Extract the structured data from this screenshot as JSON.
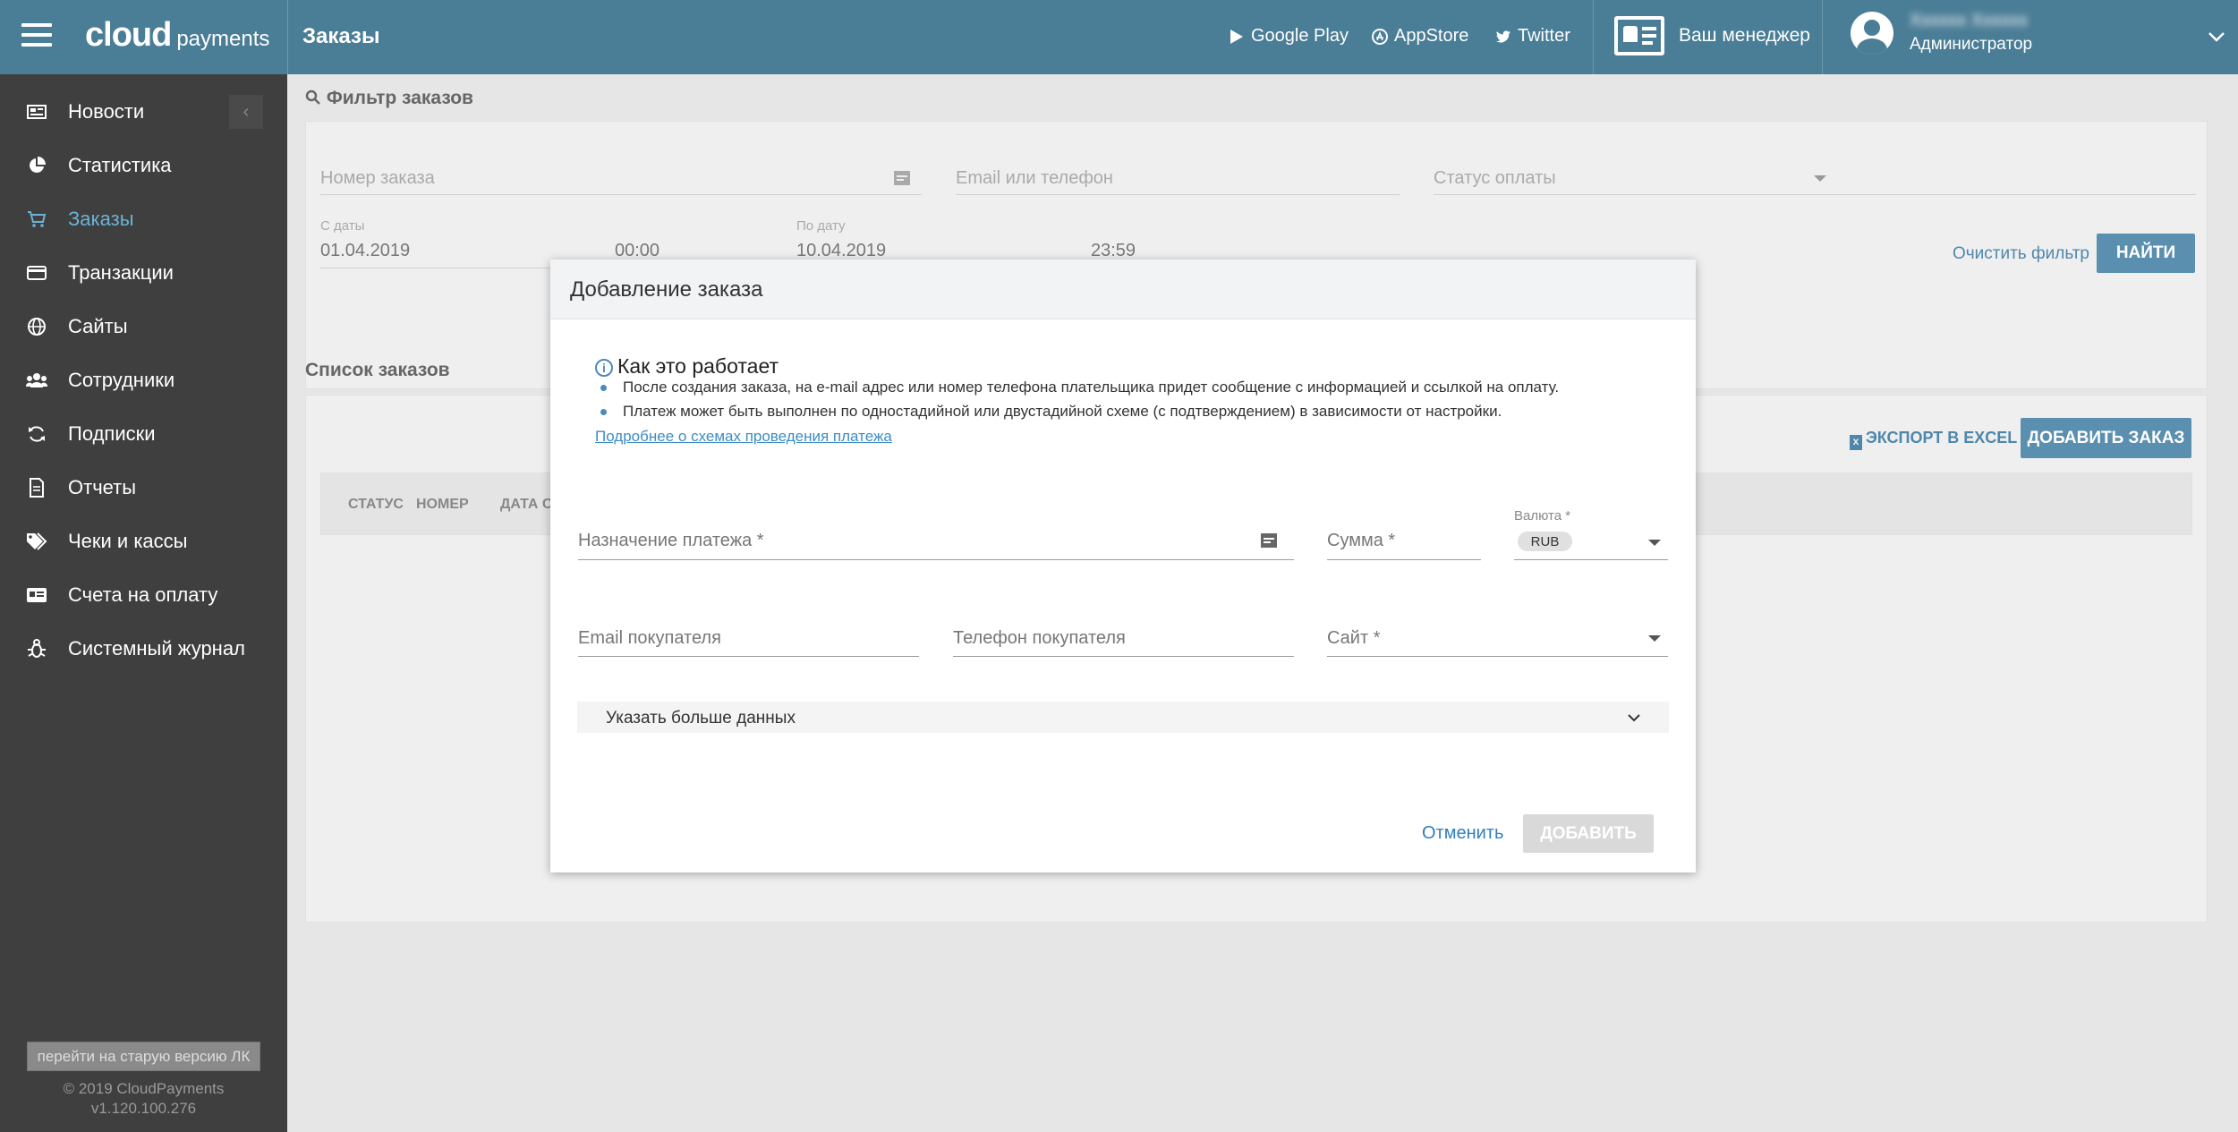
{
  "header": {
    "logo_main": "cloud",
    "logo_sub": "payments",
    "page_title": "Заказы",
    "links": [
      {
        "label": "Google Play",
        "icon": "play-icon"
      },
      {
        "label": "AppStore",
        "icon": "appstore-icon"
      },
      {
        "label": "Twitter",
        "icon": "twitter-icon"
      }
    ],
    "manager_label": "Ваш менеджер",
    "user_name": "Хххххх Хххххх",
    "user_role": "Администратор"
  },
  "sidebar": {
    "items": [
      {
        "label": "Новости",
        "icon": "news-icon"
      },
      {
        "label": "Статистика",
        "icon": "pie-chart-icon"
      },
      {
        "label": "Заказы",
        "icon": "cart-icon",
        "active": true
      },
      {
        "label": "Транзакции",
        "icon": "card-icon"
      },
      {
        "label": "Сайты",
        "icon": "globe-icon"
      },
      {
        "label": "Сотрудники",
        "icon": "users-icon"
      },
      {
        "label": "Подписки",
        "icon": "refresh-icon"
      },
      {
        "label": "Отчеты",
        "icon": "document-icon"
      },
      {
        "label": "Чеки и кассы",
        "icon": "tags-icon"
      },
      {
        "label": "Счета на оплату",
        "icon": "invoice-icon"
      },
      {
        "label": "Системный журнал",
        "icon": "bug-icon"
      }
    ],
    "old_version": "перейти на старую версию ЛК",
    "copyright": "© 2019 CloudPayments",
    "version": "v1.120.100.276"
  },
  "filter": {
    "title": "Фильтр заказов",
    "order_number_placeholder": "Номер заказа",
    "email_phone_placeholder": "Email или телефон",
    "payment_status_placeholder": "Статус оплаты",
    "date_from_label": "С даты",
    "date_from": "01.04.2019",
    "time_from": "00:00",
    "date_to_label": "По дату",
    "date_to": "10.04.2019",
    "time_to": "23:59",
    "clear_label": "Очистить фильтр",
    "find_label": "НАЙТИ"
  },
  "orders": {
    "title": "Список заказов",
    "export_label": "ЭКСПОРТ В EXCEL",
    "add_label": "ДОБАВИТЬ ЗАКАЗ",
    "columns": [
      "СТАТУС",
      "НОМЕР",
      "ДАТА СО"
    ]
  },
  "modal": {
    "title": "Добавление заказа",
    "info_title": "Как это работает",
    "bullets": [
      "После создания заказа, на e-mail адрес или номер телефона плательщика придет сообщение с информацией и ссылкой на оплату.",
      "Платеж может быть выполнен по одностадийной или двустадийной схеме (с подтверждением) в зависимости от настройки."
    ],
    "more_link": "Подробнее о схемах проведения платежа",
    "purpose_label": "Назначение платежа  *",
    "amount_label": "Сумма *",
    "currency_label": "Валюта *",
    "currency_value": "RUB",
    "email_label": "Email покупателя",
    "phone_label": "Телефон покупателя",
    "site_label": "Сайт *",
    "more_data_label": "Указать больше данных",
    "cancel_label": "Отменить",
    "add_label": "ДОБАВИТЬ"
  }
}
